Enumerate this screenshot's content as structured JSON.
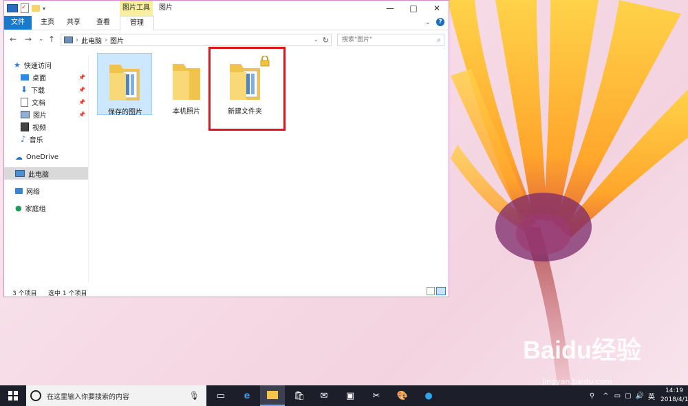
{
  "window": {
    "title": "图片",
    "context_tab": "图片工具",
    "minimize": "—",
    "maximize": "□",
    "close": "✕"
  },
  "ribbon": {
    "tabs": [
      {
        "label": "文件"
      },
      {
        "label": "主页"
      },
      {
        "label": "共享"
      },
      {
        "label": "查看"
      },
      {
        "label": "管理"
      }
    ],
    "expand": "⌄",
    "help": "?"
  },
  "address": {
    "back": "←",
    "forward": "→",
    "recent": "⌄",
    "up": "↑",
    "path": [
      "此电脑",
      "图片"
    ],
    "dropdown": "⌄",
    "refresh": "↻",
    "search_placeholder": "搜索\"图片\""
  },
  "nav": {
    "quick_access": "快速访问",
    "items": [
      {
        "label": "桌面",
        "pinned": true
      },
      {
        "label": "下载",
        "pinned": true
      },
      {
        "label": "文档",
        "pinned": true
      },
      {
        "label": "图片",
        "pinned": true
      },
      {
        "label": "视频",
        "pinned": false
      },
      {
        "label": "音乐",
        "pinned": false
      }
    ],
    "onedrive": "OneDrive",
    "this_pc": "此电脑",
    "network": "网络",
    "homegroup": "家庭组"
  },
  "content": {
    "items": [
      {
        "label": "保存的图片",
        "selected": true
      },
      {
        "label": "本机照片",
        "selected": false
      },
      {
        "label": "新建文件夹",
        "selected": false
      }
    ]
  },
  "status": {
    "count": "3 个项目",
    "selected": "选中 1 个项目"
  },
  "taskbar": {
    "search_placeholder": "在这里输入你要搜索的内容",
    "lang": "英",
    "time": "14:19",
    "date": "2018/4/1"
  },
  "watermark": {
    "brand": "Baidu经验",
    "url": "jingyan.baidu.com"
  },
  "colors": {
    "accent": "#1979ca",
    "context_tab": "#f7ef9f",
    "highlight": "#e0141b",
    "selection": "#cce8ff"
  }
}
